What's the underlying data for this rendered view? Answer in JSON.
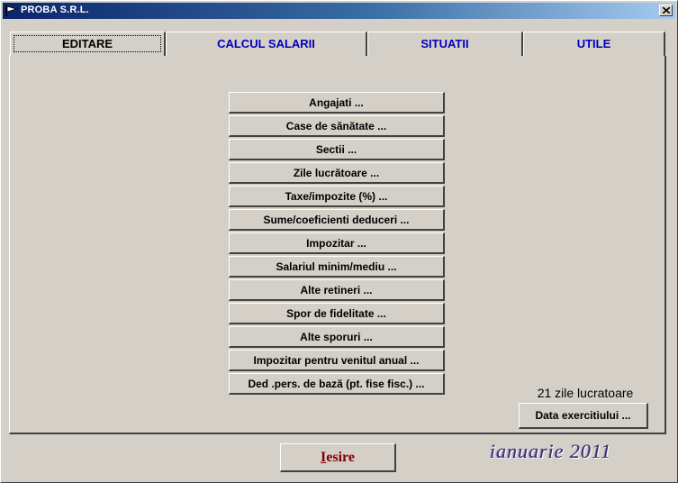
{
  "window": {
    "title": "PROBA S.R.L."
  },
  "tabs": [
    {
      "label": "EDITARE",
      "active": true
    },
    {
      "label": "CALCUL SALARII",
      "active": false
    },
    {
      "label": "SITUATII",
      "active": false
    },
    {
      "label": "UTILE",
      "active": false
    }
  ],
  "menu": [
    "Angajati ...",
    "Case de sănătate  ...",
    "Sectii ...",
    "Zile lucrătoare ...",
    "Taxe/impozite (%) ...",
    "Sume/coeficienti deduceri ...",
    "Impozitar ...",
    "Salariul minim/mediu ...",
    "Alte retineri ...",
    "Spor de fidelitate ...",
    "Alte sporuri ...",
    "Impozitar pentru venitul anual ...",
    "Ded .pers. de bază (pt. fise fisc.) ..."
  ],
  "status": {
    "working_days": "21 zile lucratoare",
    "period": "ianuarie 2011"
  },
  "buttons": {
    "data_exercitiu": "Data exercitiului ...",
    "exit_accel": "I",
    "exit_rest": "esire"
  },
  "colors": {
    "tab_text": "#0000c0",
    "exit_text": "#800000",
    "titlebar": "#0a246a"
  },
  "icons": {
    "app": "flag-icon",
    "close": "close-icon"
  }
}
